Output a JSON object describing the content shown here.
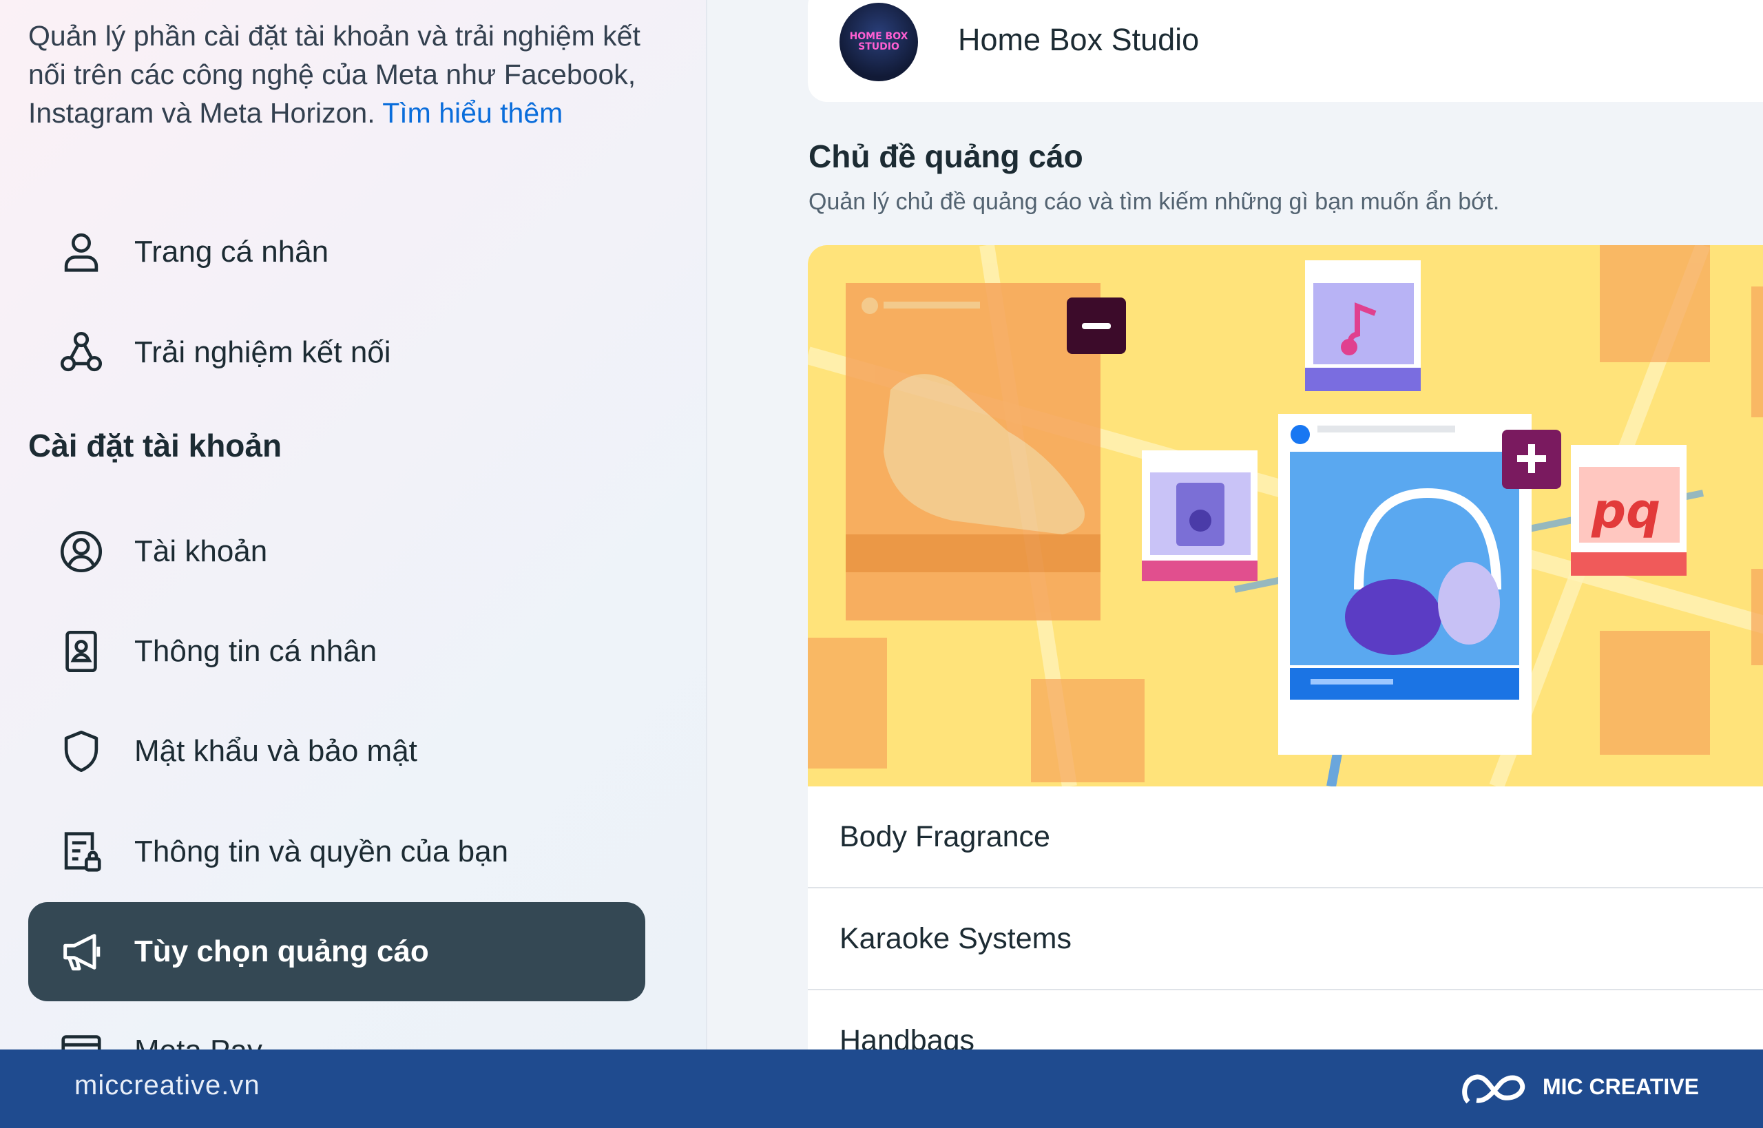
{
  "sidebar": {
    "intro_text": "Quản lý phần cài đặt tài khoản và trải nghiệm kết nối trên các công nghệ của Meta như Facebook, Instagram và Meta Horizon. ",
    "learn_more": "Tìm hiểu thêm",
    "items_top": [
      {
        "label": "Trang cá nhân",
        "icon": "person-icon"
      },
      {
        "label": "Trải nghiệm kết nối",
        "icon": "connected-icon"
      }
    ],
    "section_title": "Cài đặt tài khoản",
    "items": [
      {
        "label": "Tài khoản",
        "icon": "account-circle-icon"
      },
      {
        "label": "Thông tin cá nhân",
        "icon": "id-card-icon"
      },
      {
        "label": "Mật khẩu và bảo mật",
        "icon": "shield-icon"
      },
      {
        "label": "Thông tin và quyền của bạn",
        "icon": "document-lock-icon"
      },
      {
        "label": "Tùy chọn quảng cáo",
        "icon": "megaphone-icon",
        "active": true
      },
      {
        "label": "Meta Pay",
        "icon": "card-icon"
      }
    ]
  },
  "main": {
    "profile": {
      "name": "Home Box Studio",
      "avatar_text": "HOME BOX STUDIO"
    },
    "topics": {
      "title": "Chủ đề quảng cáo",
      "subtitle": "Quản lý chủ đề quảng cáo và tìm kiếm những gì bạn muốn ẩn bớt.",
      "list": [
        "Body Fragrance",
        "Karaoke Systems",
        "Handbags"
      ]
    }
  },
  "footer": {
    "url": "miccreative.vn",
    "brand": "MIC CREATIVE"
  },
  "colors": {
    "active_bg": "#344854",
    "link": "#0a6ddb",
    "banner_yellow": "#ffe37a",
    "footer_bg": "#1f4b8f"
  }
}
